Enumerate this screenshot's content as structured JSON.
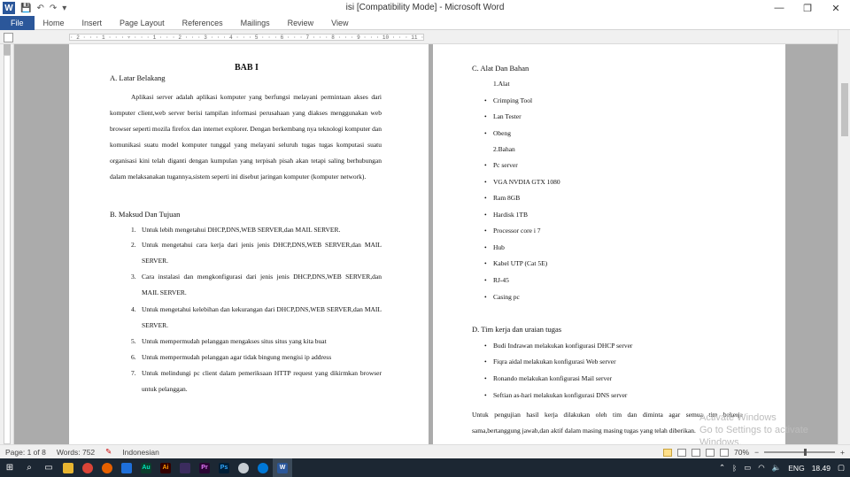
{
  "window": {
    "title": "isi [Compatibility Mode]  -  Microsoft Word",
    "minimize": "—",
    "restore": "❐",
    "close": "✕"
  },
  "quick_access": {
    "save": "💾",
    "undo": "↶",
    "redo": "↷",
    "customize": "▾"
  },
  "ribbon": {
    "tabs": [
      "File",
      "Home",
      "Insert",
      "Page Layout",
      "References",
      "Mailings",
      "Review",
      "View"
    ]
  },
  "ruler": {
    "marks": "· 2 · · · 1 · · · ▿ · · · 1 · · · 2 · · · 3 · · · 4 · · · 5 · · · 6 · · · 7 · · · 8 · · · 9 · · · 10 · · · 11 · · · 12 · · · 13 · · · 14 · · · 15 · · · 16 · · · 17 · · · 18 · · · 19"
  },
  "page1": {
    "bab": "BAB I",
    "a_heading": "A.  Latar Belakang",
    "paragraph": "Aplikasi server adalah aplikasi komputer yang berfungsi melayani permintaan akses dari komputer client,web server berisi tampilan informasi perusahaan yang diakses menggunakan web browser seperti mozila firefox dan internet explorer. Dengan berkembang nya teknologi komputer dan komunikasi suatu model komputer tunggal yang melayani seluruh tugas tugas komputasi suatu organisasi kini telah diganti dengan kumpulan yang terpisah pisah akan tetapi saling berhubungan dalam melaksanakan tugannya,sistem seperti ini disebut jaringan komputer (komputer network).",
    "b_heading": "B.  Maksud Dan Tujuan",
    "items": [
      {
        "n": "1.",
        "t": "Untuk lebih mengetahui DHCP,DNS,WEB SERVER,dan MAIL SERVER."
      },
      {
        "n": "2.",
        "t": "Untuk mengetahui cara kerja dari jenis jenis DHCP,DNS,WEB SERVER,dan MAIL SERVER."
      },
      {
        "n": "3.",
        "t": "Cara instalasi dan mengkonfigurasi dari jenis jenis DHCP,DNS,WEB SERVER,dan MAIL SERVER."
      },
      {
        "n": "4.",
        "t": "Untuk mengetahui kelebihan dan kekurangan dari DHCP,DNS,WEB SERVER,dan MAIL SERVER."
      },
      {
        "n": "5.",
        "t": "Untuk mempermudah pelanggan mengakses situs situs yang kita buat"
      },
      {
        "n": "6.",
        "t": "Untuk mempermudah pelanggan agar tidak bingung mengisi ip address"
      },
      {
        "n": "7.",
        "t": "Untuk melindungi pc client dalam pemeriksaan HTTP request yang dikirmkan browser untuk pelanggan."
      }
    ]
  },
  "page2": {
    "c_heading": "C.  Alat Dan Bahan",
    "alat_label": "1.Alat",
    "alat": [
      "Crimping Tool",
      "Lan Tester",
      "Obeng"
    ],
    "bahan_label": "2.Bahan",
    "bahan": [
      "Pc server",
      "VGA NVDIA GTX 1080",
      "Ram 8GB",
      "Hardisk 1TB",
      "Processor core i 7",
      "Hub",
      "Kabel UTP (Cat 5E)",
      "RJ-45",
      "Casing pc"
    ],
    "d_heading": "D.  Tim kerja dan uraian tugas",
    "tim": [
      "Budi Indrawan melakukan konfigurasi DHCP server",
      "Fiqra aidal melakukan konfigurasi Web server",
      "Ronando melakukan konfigurasi Mail server",
      "Seftian  as-hari melakukan konfigurasi DNS  server"
    ],
    "closing": "Untuk pengujian hasil kerja dilakukan oleh tim dan diminta agar semua tim bekerja sama,bertanggung jawab,dan aktif dalam masing masing tugas yang telah diberikan."
  },
  "watermark": {
    "line1": "Activate Windows",
    "line2": "Go to Settings to activate Windows."
  },
  "status": {
    "page": "Page: 1 of 8",
    "words": "Words: 752",
    "language": "Indonesian",
    "zoom": "70%",
    "zoom_out": "−",
    "zoom_in": "+"
  },
  "taskbar": {
    "lang": "ENG",
    "time": "18.49"
  }
}
